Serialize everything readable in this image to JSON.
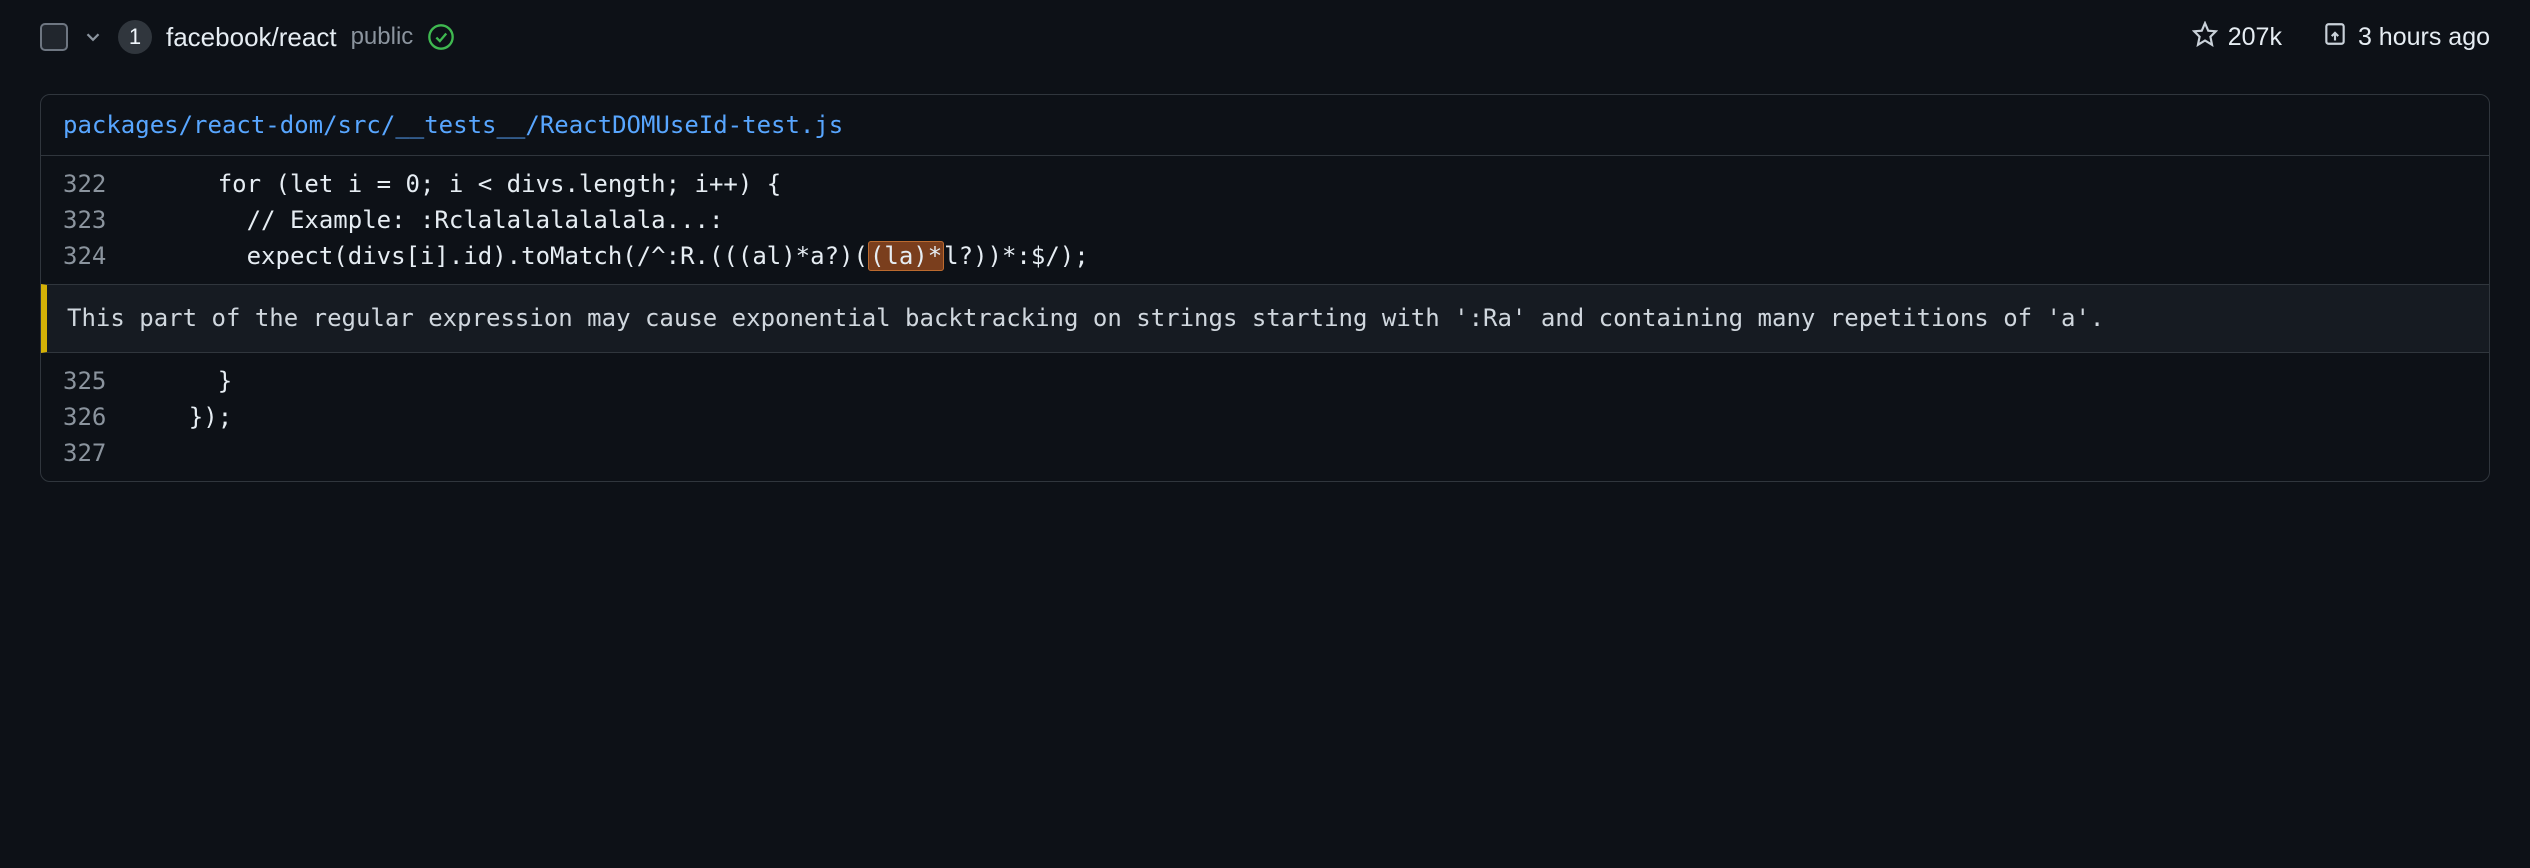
{
  "header": {
    "count": "1",
    "repo": "facebook/react",
    "visibility": "public",
    "stars": "207k",
    "pushed": "3 hours ago"
  },
  "file": {
    "path": "packages/react-dom/src/__tests__/ReactDOMUseId-test.js"
  },
  "code": {
    "lines": [
      {
        "num": "322",
        "text": "      for (let i = 0; i < divs.length; i++) {"
      },
      {
        "num": "323",
        "text": "        // Example: :Rclalalalalalala...:"
      },
      {
        "num": "324",
        "pre": "        expect(divs[i].id).toMatch(/^:R.(((al)*a?)(",
        "hl": "(la)*",
        "post": "l?))*:$/);"
      },
      {
        "num": "325",
        "text": "      }"
      },
      {
        "num": "326",
        "text": "    });"
      },
      {
        "num": "327",
        "text": ""
      }
    ],
    "annotation": "This part of the regular expression may cause exponential backtracking on strings starting with ':Ra' and containing many repetitions of 'a'."
  }
}
